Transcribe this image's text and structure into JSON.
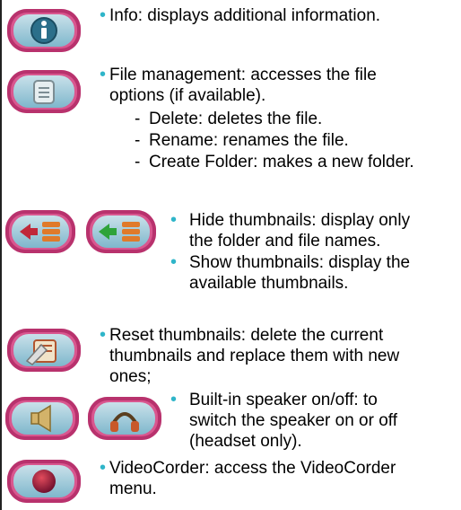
{
  "items": {
    "info": "Info: displays additional information.",
    "file_management": [
      "File management: accesses the file",
      "options (if available)."
    ],
    "file_sub": [
      {
        "dash": "-",
        "text": "Delete: deletes the file."
      },
      {
        "dash": "-",
        "text": "Rename: renames the file."
      },
      {
        "dash": "-",
        "text": "Create Folder: makes a new folder."
      }
    ],
    "hide_thumbnails": [
      "Hide thumbnails: display only",
      "the folder and file names."
    ],
    "show_thumbnails": [
      "Show thumbnails: display the",
      "available thumbnails."
    ],
    "reset_thumbnails": [
      "Reset thumbnails: delete the current",
      "thumbnails and replace them with new",
      "ones;"
    ],
    "speaker": [
      "Built-in speaker on/off: to",
      "switch the speaker on or off",
      "(headset only)."
    ],
    "videocorder": [
      "VideoCorder: access the VideoCorder",
      "menu."
    ]
  },
  "bullet_char": "•",
  "colors": {
    "bullet": "#2fb5c9",
    "button_border": "#b8326d",
    "button_fill": "#d9578f"
  },
  "icons": [
    "info-icon",
    "file-options-icon",
    "hide-thumbnails-icon",
    "show-thumbnails-icon",
    "reset-thumbnails-icon",
    "speaker-icon",
    "headset-icon",
    "videocorder-icon"
  ]
}
